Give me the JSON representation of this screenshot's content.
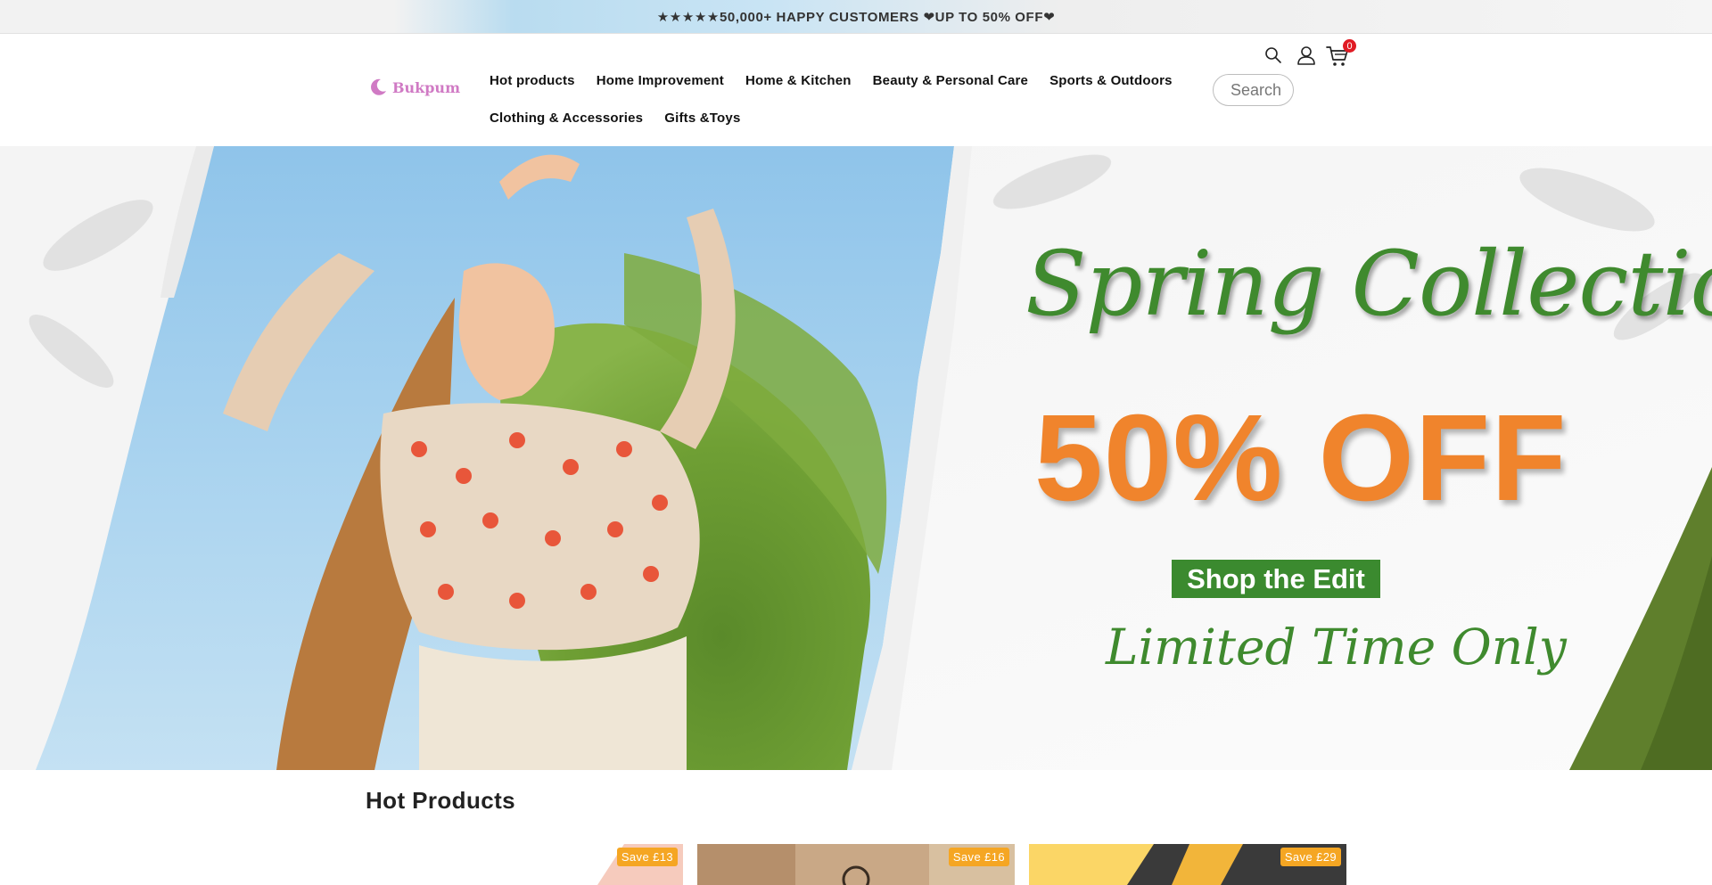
{
  "announcement": {
    "text": "★★★★★50,000+ HAPPY CUSTOMERS ❤UP TO 50% OFF❤"
  },
  "header": {
    "logo_text": "Bukpum",
    "nav_row1": [
      "Hot products",
      "Home Improvement",
      "Home & Kitchen",
      "Beauty & Personal Care",
      "Sports & Outdoors"
    ],
    "nav_row2": [
      "Clothing & Accessories",
      "Gifts &Toys"
    ],
    "search_placeholder": "Search",
    "cart_count": "0",
    "colors": {
      "logo": "#d07ac4",
      "badge": "#e01b24"
    },
    "icons": [
      "moon-logo-icon",
      "search-icon",
      "account-icon",
      "cart-icon"
    ]
  },
  "hero": {
    "title": "Spring Collection",
    "discount": "50% OFF",
    "cta_label": "Shop the Edit",
    "tagline": "Limited Time Only",
    "colors": {
      "title": "#3f8a2e",
      "discount": "#f0842c",
      "cta_bg": "#3b8a2f"
    }
  },
  "hot_products": {
    "title": "Hot Products",
    "items": [
      {
        "save_label": "Save £13"
      },
      {
        "save_label": "Save £16"
      },
      {
        "save_label": "Save £29"
      }
    ],
    "colors": {
      "save_badge": "#f5a623"
    }
  }
}
